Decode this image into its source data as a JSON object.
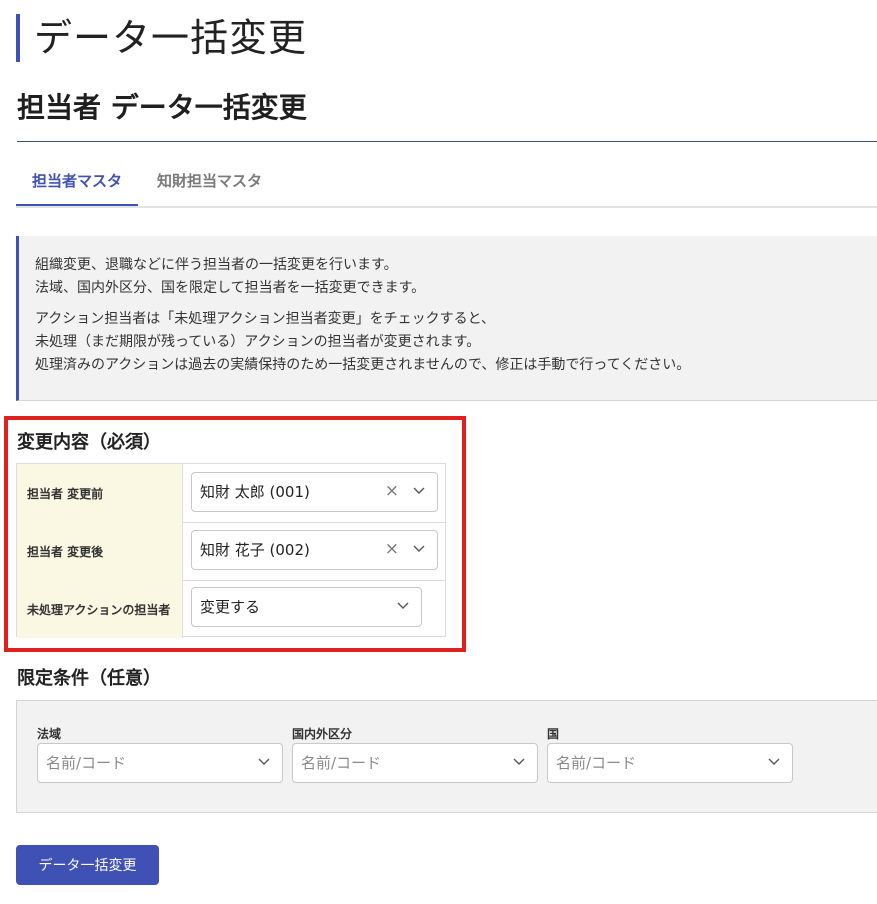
{
  "page": {
    "title": "データ一括変更"
  },
  "section": {
    "title": "担当者 データ一括変更"
  },
  "tabs": [
    {
      "label": "担当者マスタ",
      "active": true
    },
    {
      "label": "知財担当マスタ",
      "active": false
    }
  ],
  "info": {
    "lines": [
      "組織変更、退職などに伴う担当者の一括変更を行います。",
      "法域、国内外区分、国を限定して担当者を一括変更できます。",
      "アクション担当者は「未処理アクション担当者変更」をチェックすると、",
      "未処理（まだ期限が残っている）アクションの担当者が変更されます。",
      "処理済みのアクションは過去の実績保持のため一括変更されませんので、修正は手動で行ってください。"
    ]
  },
  "change": {
    "heading": "変更内容（必須）",
    "rows": [
      {
        "label": "担当者 変更前",
        "value": "知財 太郎 (001)"
      },
      {
        "label": "担当者 変更後",
        "value": "知財 花子 (002)"
      },
      {
        "label": "未処理アクションの担当者",
        "value": "変更する"
      }
    ]
  },
  "filters": {
    "heading": "限定条件（任意）",
    "fields": [
      {
        "label": "法域",
        "placeholder": "名前/コード"
      },
      {
        "label": "国内外区分",
        "placeholder": "名前/コード"
      },
      {
        "label": "国",
        "placeholder": "名前/コード"
      }
    ]
  },
  "submit": {
    "label": "データ一括変更"
  },
  "icons": {
    "clear": "close-icon",
    "dropdown": "chevron-down-icon"
  },
  "colors": {
    "accent": "#3f51b5",
    "highlight": "#e0201e",
    "label_bg": "#faf7e3"
  }
}
